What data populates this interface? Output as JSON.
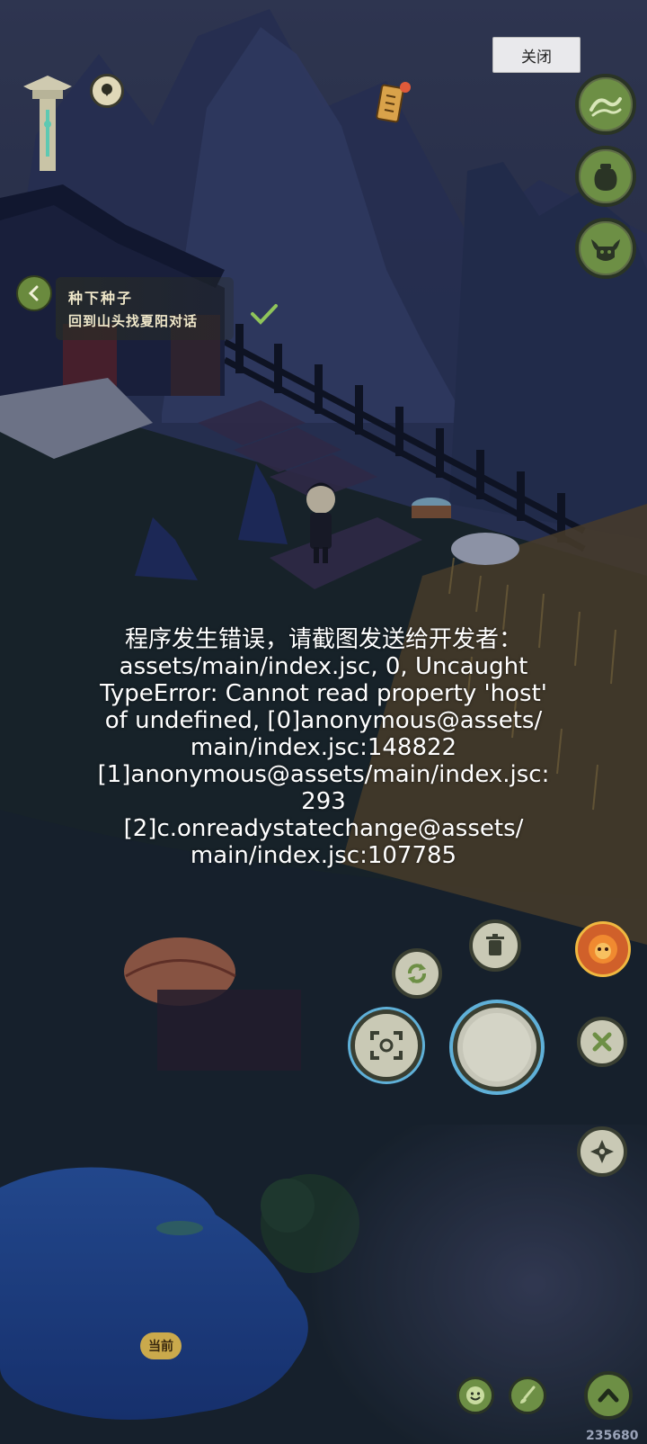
{
  "close_button": {
    "label": "关闭"
  },
  "quest": {
    "title": "种下种子",
    "objective": "回到山头找夏阳对话"
  },
  "error": {
    "lines": [
      "程序发生错误，请截图发送给开发者：",
      "assets/main/index.jsc, 0, Uncaught",
      "TypeError: Cannot read property 'host'",
      "of undefined, [0]anonymous@assets/",
      "main/index.jsc:148822",
      "[1]anonymous@assets/main/index.jsc:",
      "293",
      "[2]c.onreadystatechange@assets/",
      "main/index.jsc:107785"
    ]
  },
  "bottom_bar": {
    "current_label": "当前"
  },
  "footer_id": "235680",
  "icons": {
    "top_right": [
      "wave-skill-icon",
      "jar-icon",
      "ox-mask-icon"
    ],
    "action": [
      "refresh-icon",
      "trash-icon",
      "scan-icon",
      "joystick-icon",
      "cancel-icon",
      "compass-icon",
      "lion-portrait-icon"
    ],
    "bottom": [
      "smile-icon",
      "brush-icon",
      "up-arrow-icon"
    ]
  },
  "colors": {
    "sky": "#2d3756",
    "ground": "#1c2a2c",
    "button_ring": "#2a3425",
    "button_fill": "#7ea34c",
    "accent_gold": "#caa94c",
    "check_green": "#8fc45a"
  }
}
